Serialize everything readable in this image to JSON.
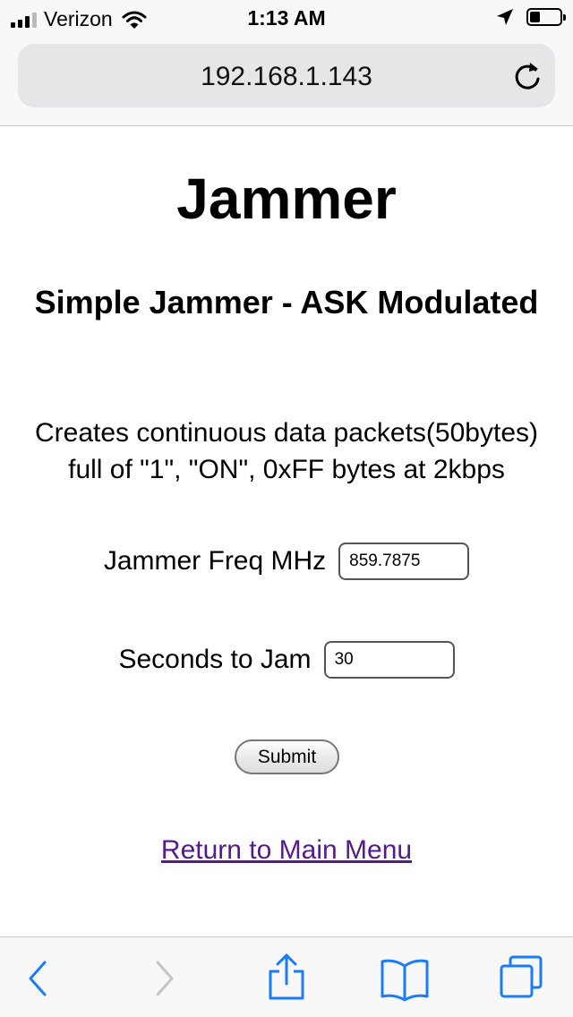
{
  "status_bar": {
    "carrier": "Verizon",
    "time": "1:13 AM",
    "icons": [
      "signal-icon",
      "wifi-icon",
      "location-arrow-icon",
      "battery-icon"
    ]
  },
  "browser": {
    "url": "192.168.1.143",
    "toolbar_icons": [
      "back-icon",
      "forward-icon",
      "share-icon",
      "bookmarks-icon",
      "tabs-icon"
    ]
  },
  "page": {
    "title": "Jammer",
    "subtitle": "Simple Jammer - ASK Modulated",
    "description_line1": "Creates continuous data packets(50bytes)",
    "description_line2": "full of \"1\", \"ON\", 0xFF bytes at 2kbps",
    "freq_label": "Jammer Freq MHz",
    "freq_value": "859.7875",
    "seconds_label": "Seconds to Jam",
    "seconds_value": "30",
    "submit_label": "Submit",
    "return_link": "Return to Main Menu"
  },
  "colors": {
    "link": "#551a8b",
    "ios_blue": "#1a7cf6",
    "disabled": "#c4c4c8"
  }
}
